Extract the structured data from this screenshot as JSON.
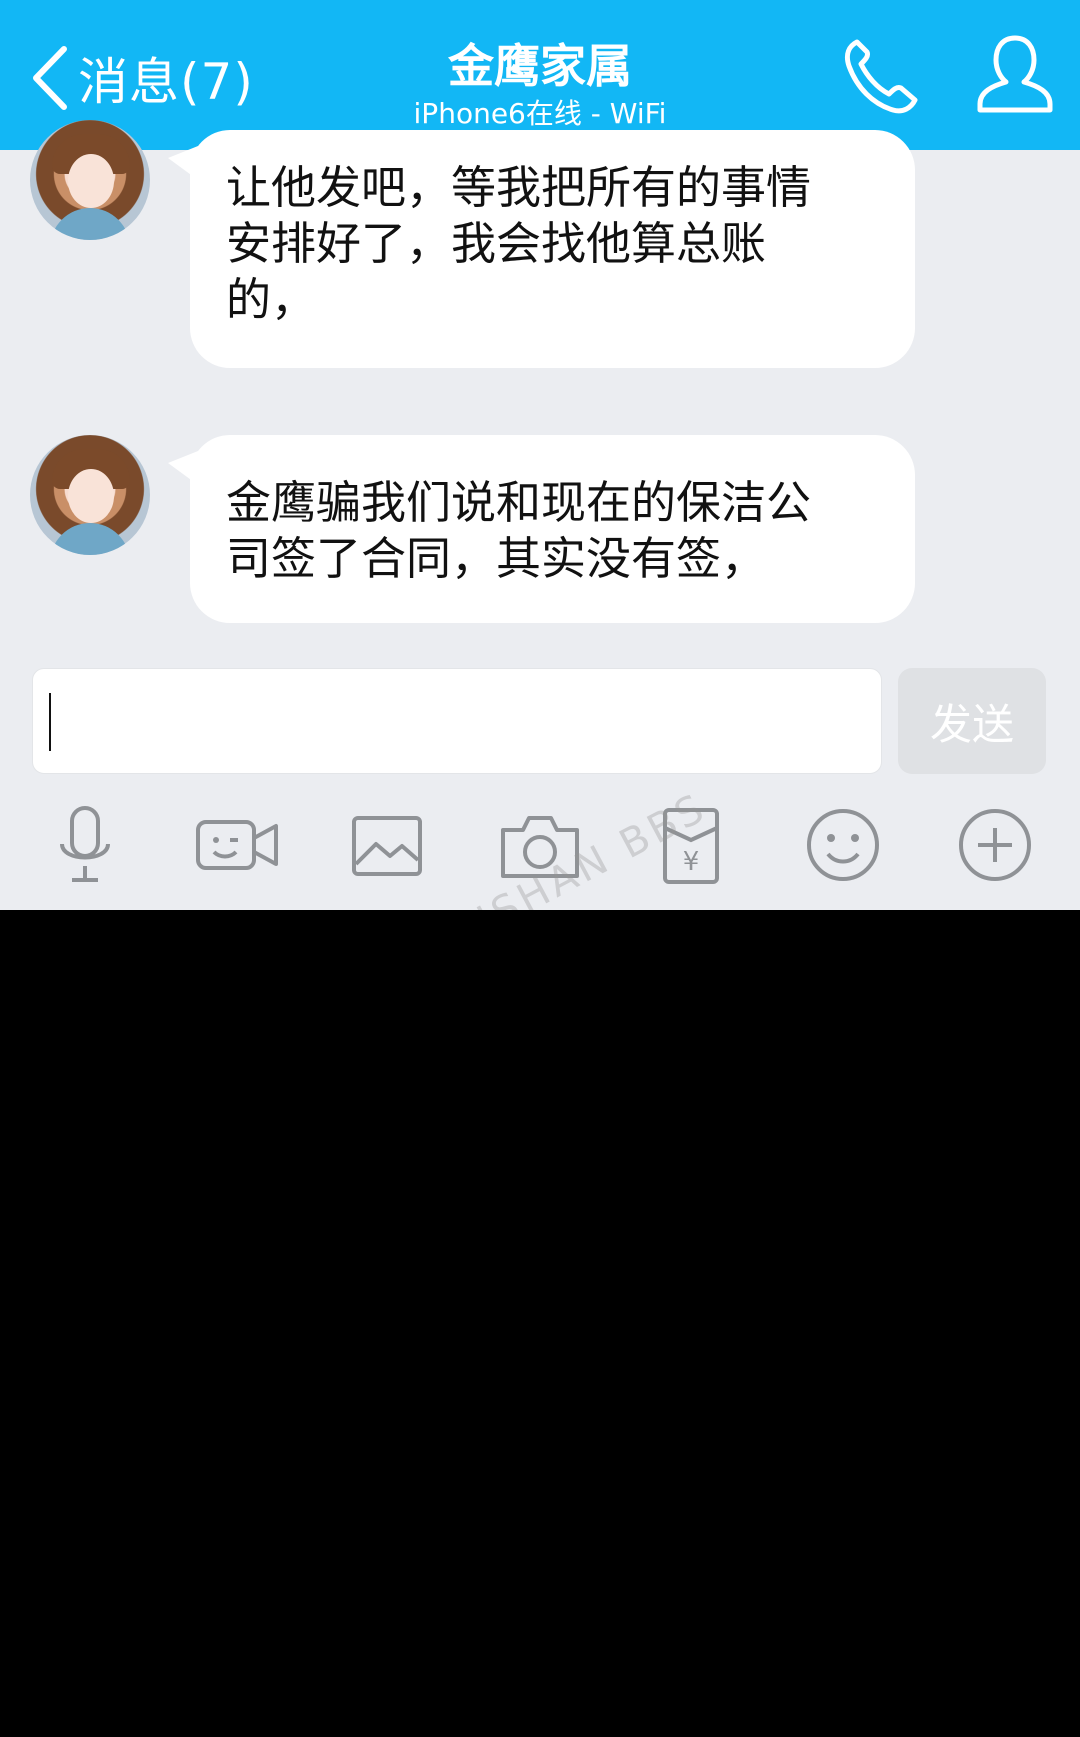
{
  "header": {
    "back_label": "消息(7)",
    "title": "金鹰家属",
    "subtitle": "iPhone6在线 - WiFi"
  },
  "messages": [
    {
      "lines": [
        "让他发吧，等我把所有的事情",
        "安排好了，我会找他算总账",
        "的，"
      ]
    },
    {
      "lines": [
        "金鹰骗我们说和现在的保洁公",
        "司签了合同，其实没有签，"
      ]
    }
  ],
  "input": {
    "value": "",
    "send_label": "发送"
  },
  "toolbar": {
    "icons": [
      "microphone-icon",
      "video-icon",
      "image-icon",
      "camera-icon",
      "red-packet-icon",
      "emoji-icon",
      "plus-icon"
    ]
  },
  "watermark": "KUNSHAN BBS",
  "colors": {
    "header_bg": "#12b7f5",
    "chat_bg": "#ebedf1",
    "bubble_bg": "#ffffff",
    "send_disabled": "#dfe1e4",
    "icon_gray": "#8f9296"
  }
}
